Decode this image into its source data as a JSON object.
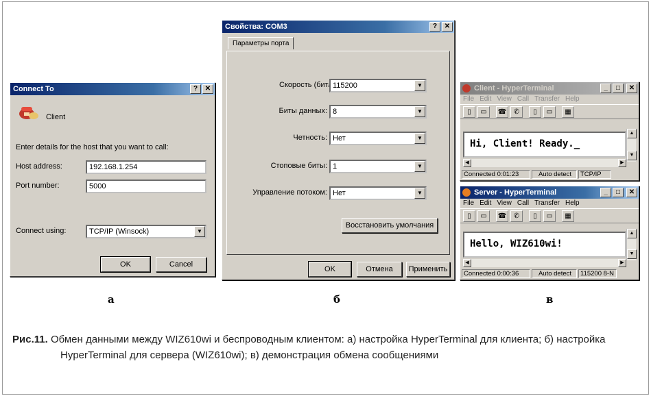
{
  "connect": {
    "title": "Connect To",
    "help_btn": "?",
    "close_btn": "✕",
    "connection_name": "Client",
    "instruction": "Enter details for the host that you want to call:",
    "host_label": "Host address:",
    "host_value": "192.168.1.254",
    "port_label": "Port number:",
    "port_value": "5000",
    "connect_label": "Connect using:",
    "connect_value": "TCP/IP (Winsock)",
    "ok": "OK",
    "cancel": "Cancel"
  },
  "props": {
    "title": "Свойства: COM3",
    "help_btn": "?",
    "close_btn": "✕",
    "tab": "Параметры порта",
    "speed_label": "Скорость (бит/с):",
    "speed_value": "115200",
    "bits_label": "Биты данных:",
    "bits_value": "8",
    "parity_label": "Четность:",
    "parity_value": "Нет",
    "stop_label": "Стоповые биты:",
    "stop_value": "1",
    "flow_label": "Управление потоком:",
    "flow_value": "Нет",
    "restore": "Восстановить умолчания",
    "ok": "OK",
    "cancel": "Отмена",
    "apply": "Применить"
  },
  "client_term": {
    "title": "Client - HyperTerminal",
    "menu": [
      "File",
      "Edit",
      "View",
      "Call",
      "Transfer",
      "Help"
    ],
    "text": "Hi, Client! Ready._",
    "status": [
      "Connected 0:01:23",
      "Auto detect",
      "TCP/IP"
    ]
  },
  "server_term": {
    "title": "Server - HyperTerminal",
    "menu": [
      "File",
      "Edit",
      "View",
      "Call",
      "Transfer",
      "Help"
    ],
    "text": "Hello, WIZ610wi!",
    "status": [
      "Connected 0:00:36",
      "Auto detect",
      "115200 8-N"
    ]
  },
  "letters": {
    "a": "а",
    "b": "б",
    "v": "в"
  },
  "caption": {
    "lead": "Рис.11.",
    "text": "Обмен данными между WIZ610wi и беспроводным клиентом: а) настройка HyperTerminal для клиента; б) настройка HyperTerminal для сервера (WIZ610wi); в) демонстрация обмена сообщениями"
  },
  "icons": {
    "phone": "phone-icon",
    "title_min": "minimize-icon",
    "title_max": "maximize-icon",
    "title_close": "close-icon"
  }
}
